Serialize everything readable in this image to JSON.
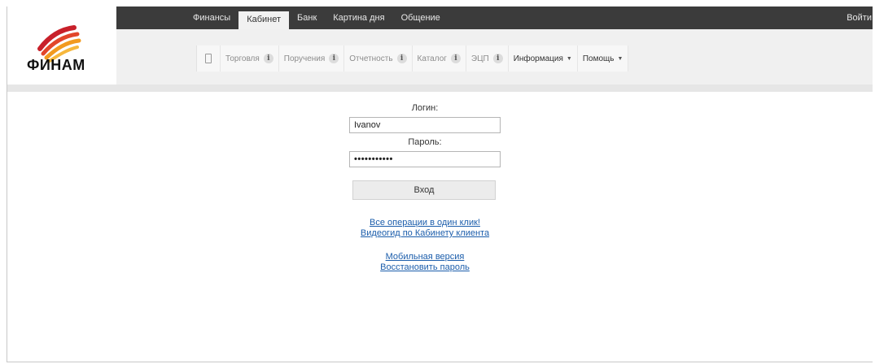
{
  "top_nav": {
    "items": [
      "Финансы",
      "Кабинет",
      "Банк",
      "Картина дня",
      "Общение"
    ],
    "active_index": 1,
    "login_label": "Войти"
  },
  "logo": {
    "text": "ФИНАМ",
    "icon": "finam-logo-icon"
  },
  "sub_nav": {
    "items": [
      {
        "label": "Торговля",
        "info": "i",
        "style": "muted"
      },
      {
        "label": "Поручения",
        "info": "i",
        "style": "muted"
      },
      {
        "label": "Отчетность",
        "info": "i",
        "style": "muted"
      },
      {
        "label": "Каталог",
        "info": "i",
        "style": "muted"
      },
      {
        "label": "ЭЦП",
        "info": "i",
        "style": "muted"
      },
      {
        "label": "Информация",
        "dropdown": "▼",
        "style": "dark"
      },
      {
        "label": "Помощь",
        "dropdown": "▼",
        "style": "dark"
      }
    ],
    "mobile_icon": "mobile-phone-icon"
  },
  "form": {
    "login_label": "Логин:",
    "login_value": "Ivanov",
    "password_label": "Пароль:",
    "password_value": "•••••••••••",
    "submit_label": "Вход"
  },
  "links": {
    "one_click": "Все операции в один клик!",
    "video_guide": "Видеогид по Кабинету клиента",
    "mobile_version": "Мобильная версия",
    "restore_password": "Восстановить пароль"
  },
  "colors": {
    "topbar": "#3b3b3b",
    "link": "#1b5dab",
    "logo_red": "#c8202a",
    "logo_orange": "#f29a1f"
  }
}
